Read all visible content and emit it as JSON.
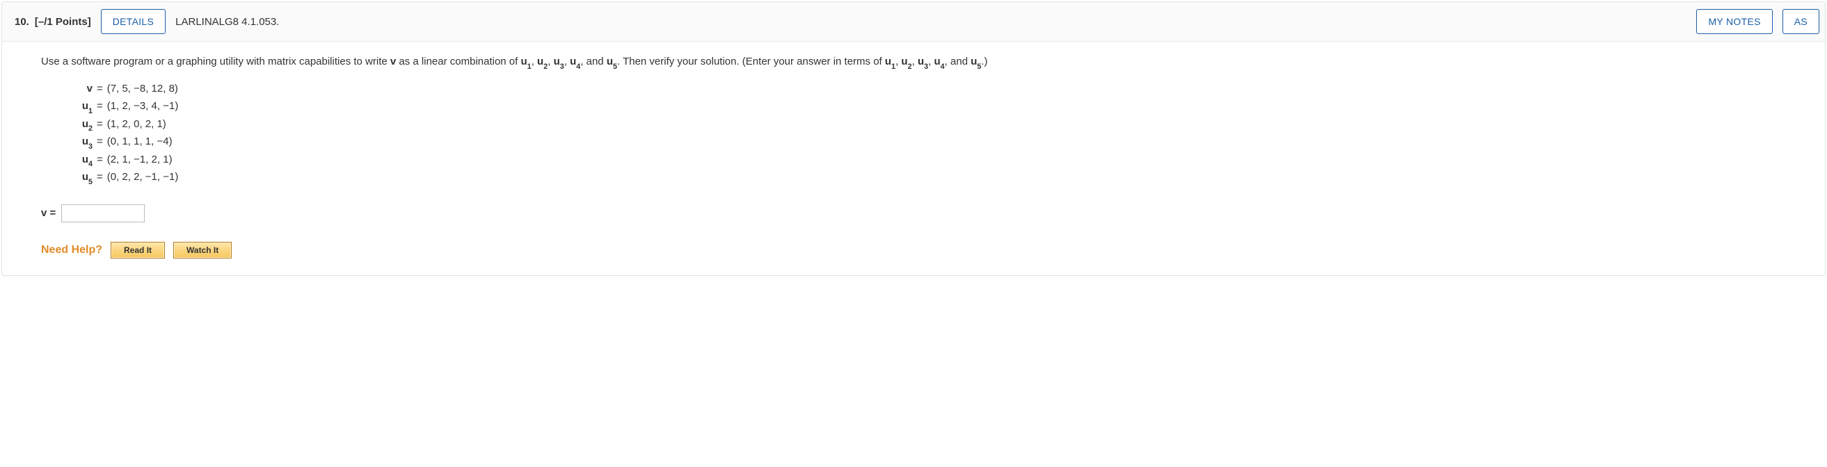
{
  "header": {
    "question_number": "10.",
    "points": "[–/1 Points]",
    "details_label": "DETAILS",
    "book_ref": "LARLINALG8 4.1.053.",
    "my_notes_label": "MY NOTES",
    "ask_label_cut": "AS"
  },
  "prompt": {
    "p1": "Use a software program or a graphing utility with matrix capabilities to write ",
    "v": "v",
    "p2": " as a linear combination of ",
    "u1": "u",
    "s1": "1",
    "c1": ", ",
    "u2": "u",
    "s2": "2",
    "c2": ", ",
    "u3": "u",
    "s3": "3",
    "c3": ", ",
    "u4": "u",
    "s4": "4",
    "c4": ", and ",
    "u5": "u",
    "s5": "5",
    "p3": ". Then verify your solution. (Enter your answer in terms of ",
    "eu1": "u",
    "es1": "1",
    "ec1": ", ",
    "eu2": "u",
    "es2": "2",
    "ec2": ", ",
    "eu3": "u",
    "es3": "3",
    "ec3": ", ",
    "eu4": "u",
    "es4": "4",
    "ec4": ", and ",
    "eu5": "u",
    "es5": "5",
    "p4": ".)"
  },
  "vectors": {
    "v": {
      "label": "v",
      "eq": "=",
      "val": "(7, 5, −8, 12, 8)"
    },
    "u1": {
      "label": "u",
      "sub": "1",
      "eq": "=",
      "val": "(1, 2, −3, 4, −1)"
    },
    "u2": {
      "label": "u",
      "sub": "2",
      "eq": "=",
      "val": "(1, 2, 0, 2, 1)"
    },
    "u3": {
      "label": "u",
      "sub": "3",
      "eq": "=",
      "val": "(0, 1, 1, 1, −4)"
    },
    "u4": {
      "label": "u",
      "sub": "4",
      "eq": "=",
      "val": "(2, 1, −1, 2, 1)"
    },
    "u5": {
      "label": "u",
      "sub": "5",
      "eq": "=",
      "val": "(0, 2, 2, −1, −1)"
    }
  },
  "answer": {
    "label": "v =",
    "value": ""
  },
  "help": {
    "label": "Need Help?",
    "read": "Read It",
    "watch": "Watch It"
  }
}
